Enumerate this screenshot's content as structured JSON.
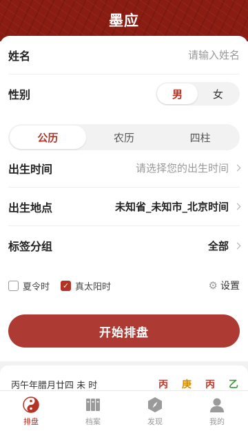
{
  "header": {
    "title": "墨应"
  },
  "form": {
    "name": {
      "label": "姓名",
      "placeholder": "请输入姓名"
    },
    "gender": {
      "label": "性别",
      "options": [
        "男",
        "女"
      ],
      "selected": "男"
    },
    "calendar_tabs": [
      "公历",
      "农历",
      "四柱"
    ],
    "calendar_selected": "公历",
    "birth_time": {
      "label": "出生时间",
      "placeholder": "请选择您的出生时间"
    },
    "birth_place": {
      "label": "出生地点",
      "value": "未知省_未知市_北京时间"
    },
    "tag_group": {
      "label": "标签分组",
      "value": "全部"
    },
    "daylight_saving": {
      "label": "夏令时",
      "checked": false
    },
    "true_solar_time": {
      "label": "真太阳时",
      "checked": true
    },
    "settings_label": "设置",
    "start_button": "开始排盘"
  },
  "info": {
    "text": "丙午年腊月廿四 未 时",
    "stems": [
      {
        "char": "丙",
        "color": "#c0392b"
      },
      {
        "char": "庚",
        "color": "#d68a00"
      },
      {
        "char": "丙",
        "color": "#c0392b"
      },
      {
        "char": "乙",
        "color": "#3a9a3a"
      }
    ]
  },
  "tabbar": {
    "items": [
      {
        "label": "排盘",
        "icon": "yin-yang-icon",
        "active": true
      },
      {
        "label": "档案",
        "icon": "archive-icon",
        "active": false
      },
      {
        "label": "发现",
        "icon": "compass-icon",
        "active": false
      },
      {
        "label": "我的",
        "icon": "user-icon",
        "active": false
      }
    ]
  },
  "colors": {
    "primary": "#b33325",
    "header": "#8b1c12",
    "button": "#ad3a33"
  }
}
